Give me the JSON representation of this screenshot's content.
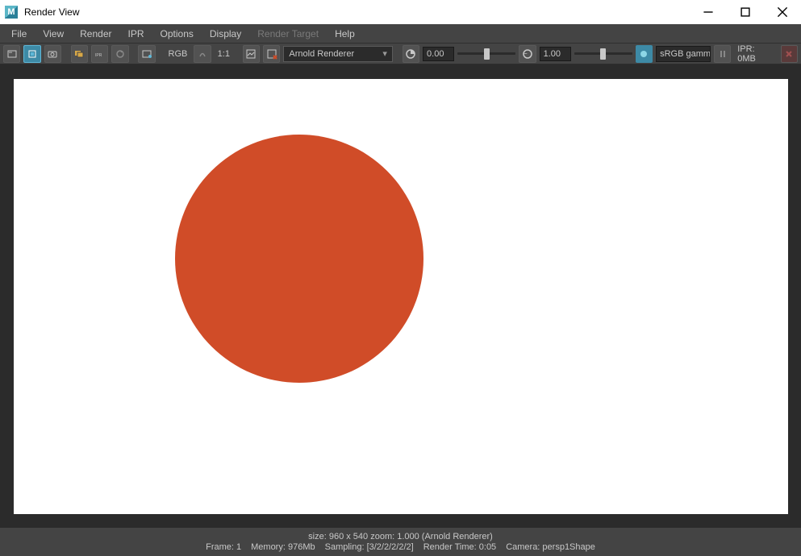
{
  "window": {
    "title": "Render View",
    "logo_letter": "M"
  },
  "menubar": {
    "items": [
      "File",
      "View",
      "Render",
      "IPR",
      "Options",
      "Display",
      "Render Target",
      "Help"
    ],
    "disabled_index": 6
  },
  "toolbar": {
    "rgb_label": "RGB",
    "ratio_label": "1:1",
    "renderer_selected": "Arnold Renderer",
    "exposure_value": "0.00",
    "gamma_value": "1.00",
    "color_mgmt": "sRGB gamm",
    "ipr_mem": "IPR: 0MB"
  },
  "render": {
    "circle_color": "#d04c28",
    "bg_color": "#ffffff"
  },
  "status": {
    "line1": "size: 960 x 540 zoom: 1.000     (Arnold Renderer)",
    "frame": "Frame: 1",
    "memory": "Memory: 976Mb",
    "sampling": "Sampling: [3/2/2/2/2/2]",
    "render_time": "Render Time: 0:05",
    "camera": "Camera: persp1Shape"
  }
}
